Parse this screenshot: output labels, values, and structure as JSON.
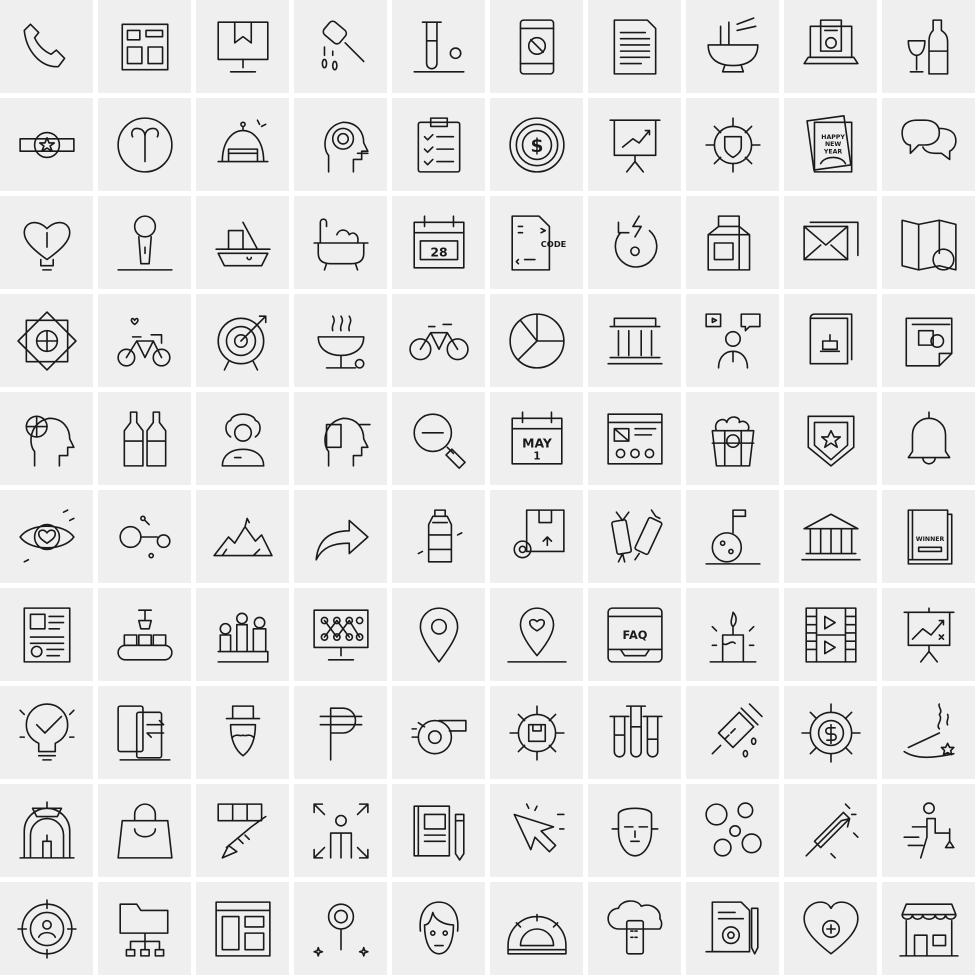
{
  "colors": {
    "cell_background": "#efefef",
    "gap": "#ffffff",
    "stroke": "#1a1a1a"
  },
  "icons": [
    {
      "name": "phone-icon"
    },
    {
      "name": "layout-icon"
    },
    {
      "name": "monitor-box-icon"
    },
    {
      "name": "honey-dipper-icon"
    },
    {
      "name": "test-tube-icon"
    },
    {
      "name": "mobile-block-icon"
    },
    {
      "name": "document-icon"
    },
    {
      "name": "noodle-bowl-icon"
    },
    {
      "name": "laptop-invoice-icon"
    },
    {
      "name": "wine-bottle-icon"
    },
    {
      "name": "star-badge-icon"
    },
    {
      "name": "aries-icon"
    },
    {
      "name": "cake-dome-icon"
    },
    {
      "name": "head-spiral-icon"
    },
    {
      "name": "clipboard-checklist-icon"
    },
    {
      "name": "dollar-coin-icon",
      "text": "$"
    },
    {
      "name": "presentation-chart-icon"
    },
    {
      "name": "gear-shield-icon"
    },
    {
      "name": "new-year-card-icon",
      "text": "HAPPY NEW YEAR"
    },
    {
      "name": "chat-bubbles-icon"
    },
    {
      "name": "heart-bulb-icon"
    },
    {
      "name": "microphone-icon"
    },
    {
      "name": "ship-icon"
    },
    {
      "name": "bathtub-icon"
    },
    {
      "name": "calendar-icon",
      "text": "28"
    },
    {
      "name": "code-file-icon",
      "text": "CODE"
    },
    {
      "name": "power-reload-icon"
    },
    {
      "name": "milk-carton-icon"
    },
    {
      "name": "mail-icon"
    },
    {
      "name": "map-star-icon"
    },
    {
      "name": "globe-network-icon"
    },
    {
      "name": "bicycle-hearts-icon"
    },
    {
      "name": "target-icon"
    },
    {
      "name": "barbecue-grill-icon"
    },
    {
      "name": "bicycle-icon"
    },
    {
      "name": "pie-chart-icon"
    },
    {
      "name": "bank-building-icon"
    },
    {
      "name": "video-conference-icon"
    },
    {
      "name": "book-cake-icon"
    },
    {
      "name": "document-chart-icon"
    },
    {
      "name": "head-globe-icon"
    },
    {
      "name": "wine-bottles-icon"
    },
    {
      "name": "woman-avatar-icon"
    },
    {
      "name": "head-mobile-icon"
    },
    {
      "name": "zoom-out-icon"
    },
    {
      "name": "calendar-may-icon",
      "text": "MAY",
      "text2": "1"
    },
    {
      "name": "browser-layout-icon"
    },
    {
      "name": "popcorn-icon"
    },
    {
      "name": "shield-star-icon"
    },
    {
      "name": "bell-icon"
    },
    {
      "name": "eye-heart-icon"
    },
    {
      "name": "molecule-icon"
    },
    {
      "name": "mountains-icon"
    },
    {
      "name": "share-arrow-icon"
    },
    {
      "name": "water-bottle-icon"
    },
    {
      "name": "box-gear-icon"
    },
    {
      "name": "candy-icon"
    },
    {
      "name": "moon-flag-icon"
    },
    {
      "name": "museum-icon"
    },
    {
      "name": "winner-book-icon",
      "text": "WINNER"
    },
    {
      "name": "resume-icon"
    },
    {
      "name": "conveyor-belt-icon"
    },
    {
      "name": "factory-robot-icon"
    },
    {
      "name": "monitor-network-icon"
    },
    {
      "name": "location-pin-icon"
    },
    {
      "name": "location-heart-icon"
    },
    {
      "name": "faq-icon",
      "text": "FAQ"
    },
    {
      "name": "candle-icon"
    },
    {
      "name": "film-strip-icon"
    },
    {
      "name": "presentation-growth-icon"
    },
    {
      "name": "bulb-check-icon"
    },
    {
      "name": "mobile-transfer-icon"
    },
    {
      "name": "gentleman-icon"
    },
    {
      "name": "peso-icon"
    },
    {
      "name": "whistle-icon"
    },
    {
      "name": "gear-box-icon"
    },
    {
      "name": "test-tubes-icon"
    },
    {
      "name": "syringe-icon"
    },
    {
      "name": "gear-dollar-icon"
    },
    {
      "name": "incense-icon"
    },
    {
      "name": "candle-lamp-icon"
    },
    {
      "name": "shopping-bag-icon"
    },
    {
      "name": "trumpet-icon"
    },
    {
      "name": "person-arrows-icon"
    },
    {
      "name": "notebook-pencil-icon"
    },
    {
      "name": "cursor-arrow-icon"
    },
    {
      "name": "face-mask-icon"
    },
    {
      "name": "bubbles-icon"
    },
    {
      "name": "firework-rocket-icon"
    },
    {
      "name": "businessman-target-icon"
    },
    {
      "name": "user-target-icon"
    },
    {
      "name": "folder-network-icon"
    },
    {
      "name": "website-layout-icon"
    },
    {
      "name": "map-pin-sparkle-icon"
    },
    {
      "name": "woman-face-icon"
    },
    {
      "name": "protractor-icon"
    },
    {
      "name": "cloud-mobile-icon"
    },
    {
      "name": "document-gear-icon"
    },
    {
      "name": "heart-plus-icon"
    },
    {
      "name": "shop-icon"
    }
  ]
}
